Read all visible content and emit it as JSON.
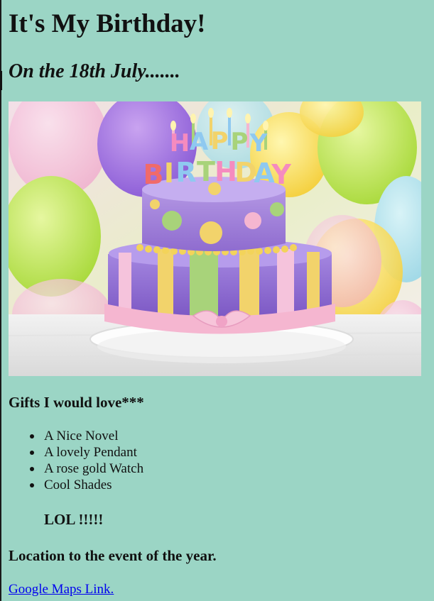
{
  "page": {
    "title": "It's My Birthday!",
    "subtitle": "On the 18th July......."
  },
  "photo": {
    "cake_text_line1": "HAPPY",
    "cake_text_line2": "BIRTHDAY"
  },
  "gifts": {
    "heading": "Gifts I would love***",
    "items": [
      "A Nice Novel",
      "A lovely Pendant",
      "A rose gold Watch",
      "Cool Shades"
    ],
    "note": "LOL !!!!!"
  },
  "location": {
    "heading": "Location to the event of the year.",
    "link_text": "Google Maps Link."
  },
  "colors": {
    "background": "#9bd5c5",
    "link": "#0000ee"
  }
}
